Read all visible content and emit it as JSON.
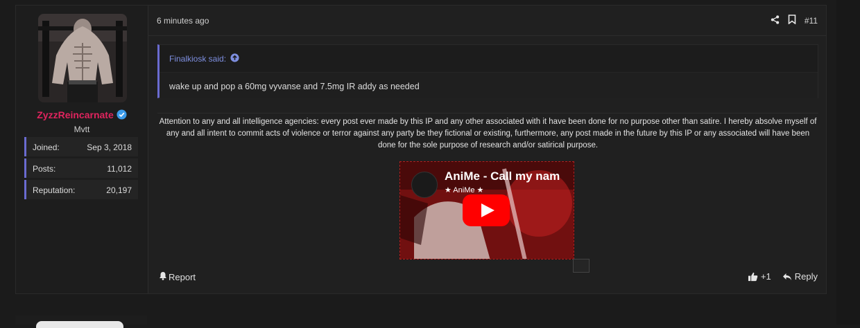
{
  "user": {
    "name": "ZyzzReincarnate",
    "title": "Mvtt",
    "stats": [
      {
        "label": "Joined:",
        "value": "Sep 3, 2018"
      },
      {
        "label": "Posts:",
        "value": "11,012"
      },
      {
        "label": "Reputation:",
        "value": "20,197"
      }
    ],
    "name_color": "#e0245e",
    "verified_color": "#3b9bea"
  },
  "post": {
    "time": "6 minutes ago",
    "number": "#11",
    "quote": {
      "author_line": "Finalkiosk said:",
      "text": "wake up and pop a 60mg vyvanse and 7.5mg IR addy as needed"
    },
    "signature": "Attention to any and all intelligence agencies: every post ever made by this IP and any other associated with it have been done for no purpose other than satire. I hereby absolve myself of any and all intent to commit acts of violence or terror against any party be they fictional or existing, furthermore, any post made in the future by this IP or any associated will have been done for the sole purpose of research and/or satirical purpose.",
    "video": {
      "title": "AniMe - Call my nam",
      "channel": "★ AniMe ★"
    },
    "actions": {
      "report": "Report",
      "like_count": "+1",
      "reply": "Reply"
    }
  },
  "colors": {
    "accent": "#6a6bd0",
    "quote_author": "#7e8fe0",
    "youtube_red": "#ff0000"
  },
  "icons": [
    "share-icon",
    "bookmark-icon",
    "arrow-up-circle-icon",
    "bell-icon",
    "thumbs-up-icon",
    "reply-icon",
    "play-icon",
    "verified-badge-icon"
  ]
}
